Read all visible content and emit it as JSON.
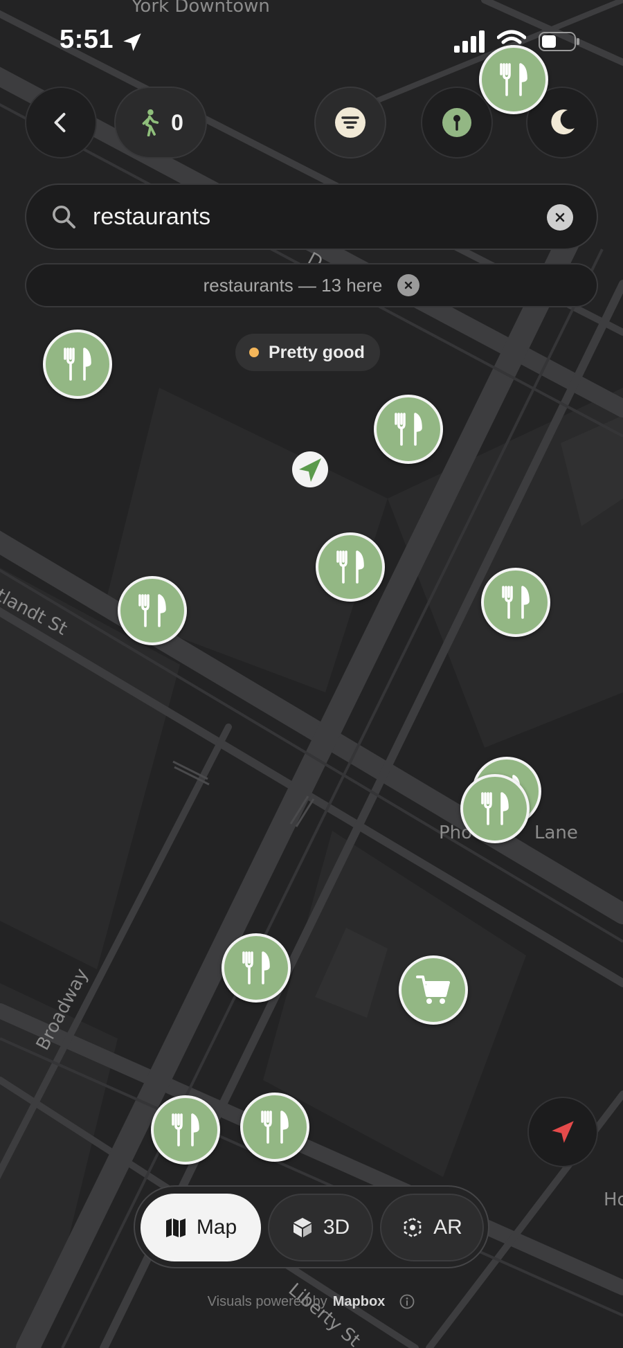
{
  "status_bar": {
    "time": "5:51"
  },
  "map": {
    "street_labels": {
      "top": "York Downtown",
      "cortlandt": "rtlandt St",
      "broadway": "Broadway",
      "liberty": "Liberty St",
      "platt": "Pho",
      "platt2": "Lane",
      "ho": "Ho",
      "d": "D"
    }
  },
  "toolbar": {
    "walk_count": "0"
  },
  "search": {
    "value": "restaurants"
  },
  "results": {
    "summary": "restaurants — 13 here"
  },
  "quality": {
    "label": "Pretty good"
  },
  "modes": {
    "map": "Map",
    "three_d": "3D",
    "ar": "AR"
  },
  "footer": {
    "prefix": "Visuals powered by",
    "brand": "Mapbox"
  },
  "colors": {
    "poi": "#93b784",
    "map_bg": "#232324",
    "road": "#3f3f41",
    "accent_red": "#e54b4b"
  },
  "icons": {
    "back": "chevron-left-icon",
    "walk": "walking-person-icon",
    "filter": "filter-lines-icon",
    "pin": "map-pin-icon",
    "night": "moon-icon",
    "search": "search-icon",
    "clear": "clear-x-icon",
    "restaurant": "fork-knife-icon",
    "shopping": "shopping-cart-icon",
    "locate": "location-arrow-icon"
  }
}
